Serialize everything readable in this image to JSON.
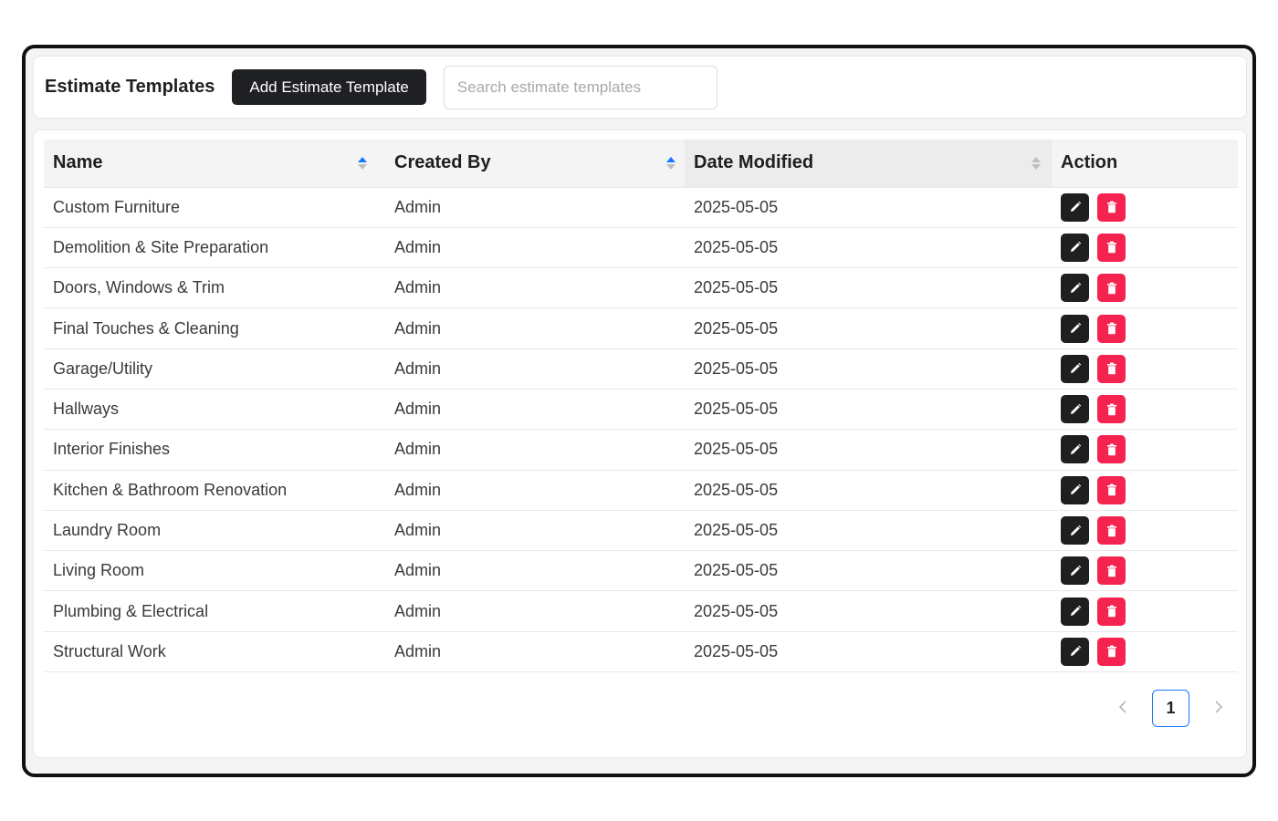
{
  "header": {
    "title": "Estimate Templates",
    "add_button_label": "Add Estimate Template",
    "search_placeholder": "Search estimate templates"
  },
  "table": {
    "columns": {
      "name": "Name",
      "created_by": "Created By",
      "date_modified": "Date Modified",
      "action": "Action"
    },
    "rows": [
      {
        "name": "Custom Furniture",
        "created_by": "Admin",
        "date_modified": "2025-05-05"
      },
      {
        "name": "Demolition & Site Preparation",
        "created_by": "Admin",
        "date_modified": "2025-05-05"
      },
      {
        "name": "Doors, Windows & Trim",
        "created_by": "Admin",
        "date_modified": "2025-05-05"
      },
      {
        "name": "Final Touches & Cleaning",
        "created_by": "Admin",
        "date_modified": "2025-05-05"
      },
      {
        "name": "Garage/Utility",
        "created_by": "Admin",
        "date_modified": "2025-05-05"
      },
      {
        "name": "Hallways",
        "created_by": "Admin",
        "date_modified": "2025-05-05"
      },
      {
        "name": "Interior Finishes",
        "created_by": "Admin",
        "date_modified": "2025-05-05"
      },
      {
        "name": "Kitchen & Bathroom Renovation",
        "created_by": "Admin",
        "date_modified": "2025-05-05"
      },
      {
        "name": "Laundry Room",
        "created_by": "Admin",
        "date_modified": "2025-05-05"
      },
      {
        "name": "Living Room",
        "created_by": "Admin",
        "date_modified": "2025-05-05"
      },
      {
        "name": "Plumbing & Electrical",
        "created_by": "Admin",
        "date_modified": "2025-05-05"
      },
      {
        "name": "Structural Work",
        "created_by": "Admin",
        "date_modified": "2025-05-05"
      }
    ],
    "row_actions": [
      "edit-icon",
      "delete-icon"
    ]
  },
  "pagination": {
    "current_page": "1",
    "prev_icon": "chevron-left-icon",
    "next_icon": "chevron-right-icon"
  },
  "colors": {
    "primary_button": "#1f2023",
    "edit_button": "#1f1f1f",
    "delete_button": "#f5234f",
    "active_sort": "#1677ff"
  }
}
